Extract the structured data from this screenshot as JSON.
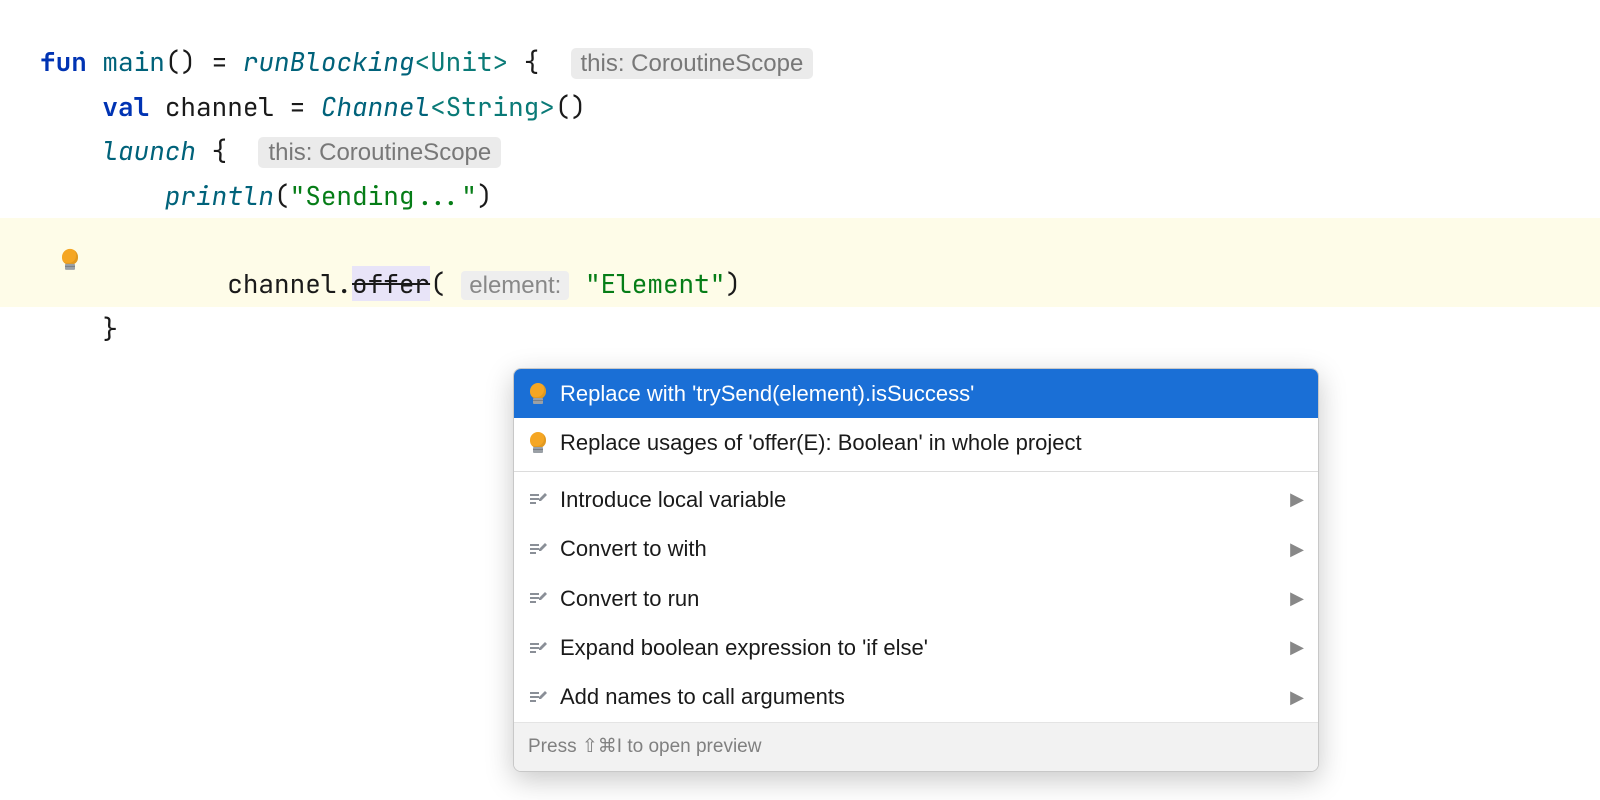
{
  "code": {
    "line1": {
      "kw_fun": "fun",
      "fname": "main",
      "parens": "()",
      "eq": "=",
      "runBlocking": "runBlocking",
      "type": "<Unit>",
      "brace": "{",
      "hint": "this: CoroutineScope"
    },
    "line2": {
      "kw_val": "val",
      "ident": "channel",
      "eq": "=",
      "ctor": "Channel",
      "type": "<String>",
      "parens": "()"
    },
    "line3": {
      "launch": "launch",
      "brace": "{",
      "hint": "this: CoroutineScope"
    },
    "line4": {
      "println": "println",
      "lparen": "(",
      "str": "\"Sending...\"",
      "rparen": ")"
    },
    "line5": {
      "obj": "channel",
      "dot": ".",
      "method": "offer",
      "lparen": "(",
      "param_hint": "element:",
      "str": "\"Element\"",
      "rparen": ")"
    },
    "line6": {
      "brace": "}"
    }
  },
  "popup": {
    "items": [
      {
        "icon": "bulb",
        "label": "Replace with 'trySend(element).isSuccess'",
        "submenu": false,
        "selected": true
      },
      {
        "icon": "bulb",
        "label": "Replace usages of 'offer(E): Boolean' in whole project",
        "submenu": false,
        "selected": false
      },
      {
        "sep": true
      },
      {
        "icon": "pencil",
        "label": "Introduce local variable",
        "submenu": true,
        "selected": false
      },
      {
        "icon": "pencil",
        "label": "Convert to with",
        "submenu": true,
        "selected": false
      },
      {
        "icon": "pencil",
        "label": "Convert to run",
        "submenu": true,
        "selected": false
      },
      {
        "icon": "pencil",
        "label": "Expand boolean expression to 'if else'",
        "submenu": true,
        "selected": false
      },
      {
        "icon": "pencil",
        "label": "Add names to call arguments",
        "submenu": true,
        "selected": false
      }
    ],
    "footer": "Press ⇧⌘I to open preview"
  }
}
